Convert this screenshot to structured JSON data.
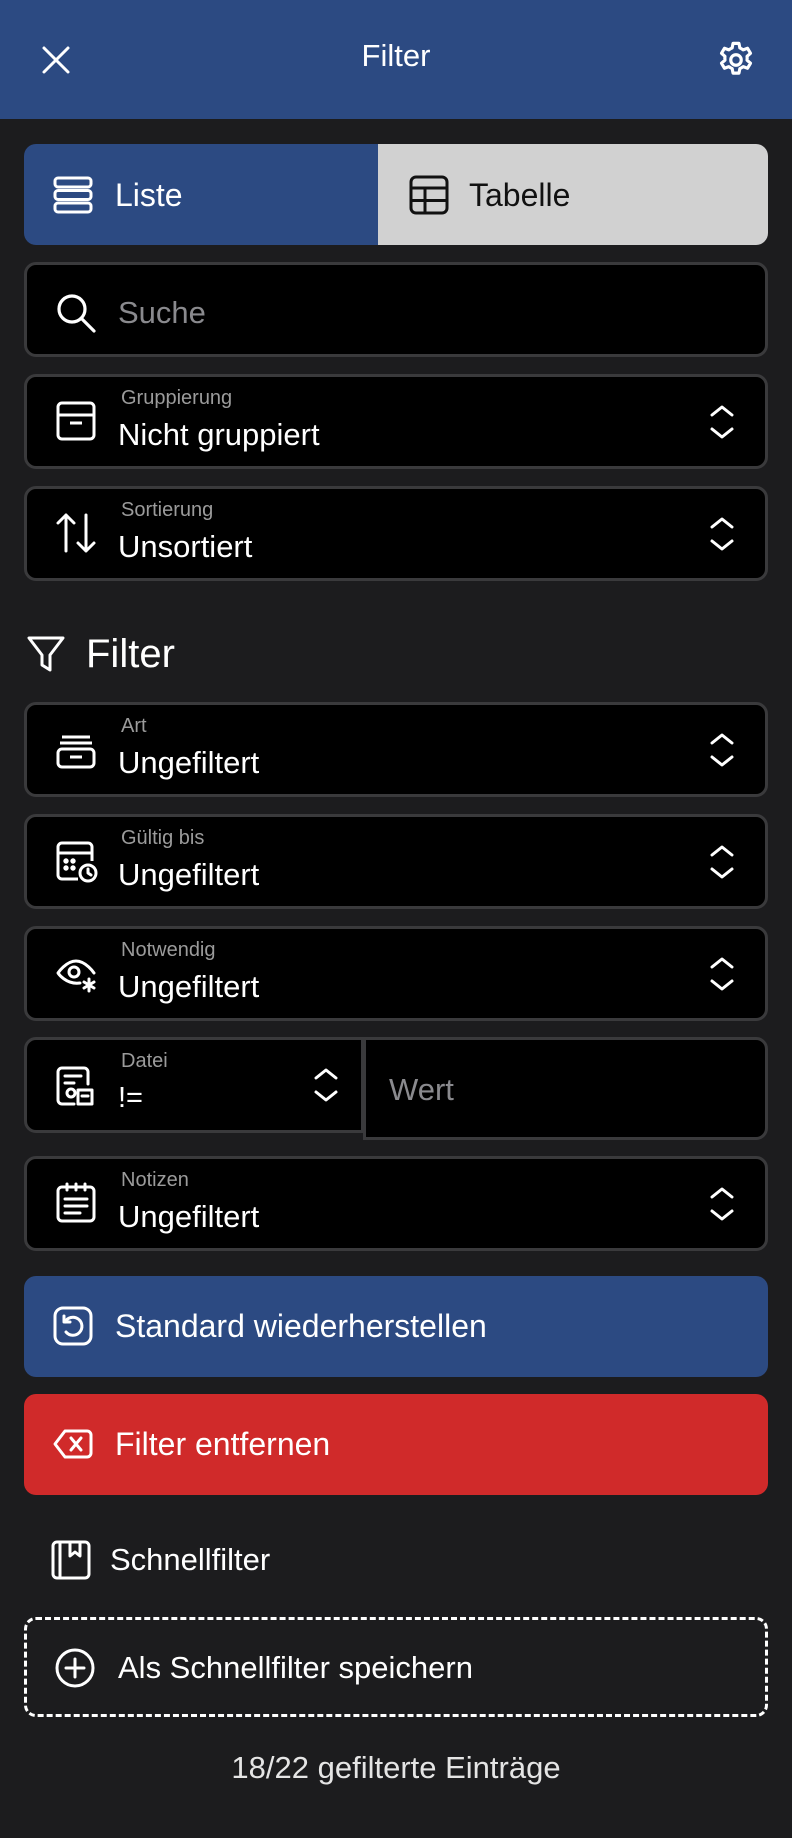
{
  "header": {
    "title": "Filter",
    "close_icon": "close-icon",
    "settings_icon": "gear-icon",
    "background": "#2c4a82"
  },
  "view_toggle": {
    "options": [
      {
        "label": "Liste",
        "icon": "list-icon",
        "selected": true
      },
      {
        "label": "Tabelle",
        "icon": "table-icon",
        "selected": false
      }
    ]
  },
  "search": {
    "placeholder": "Suche",
    "value": ""
  },
  "grouping": {
    "label": "Gruppierung",
    "value": "Nicht gruppiert",
    "icon": "archive-box-icon"
  },
  "sorting": {
    "label": "Sortierung",
    "value": "Unsortiert",
    "icon": "sort-arrows-icon"
  },
  "filter_section": {
    "title": "Filter",
    "icon": "funnel-icon",
    "fields": [
      {
        "label": "Art",
        "value": "Ungefiltert",
        "icon": "inbox-stack-icon"
      },
      {
        "label": "Gültig bis",
        "value": "Ungefiltert",
        "icon": "calendar-clock-icon"
      },
      {
        "label": "Notwendig",
        "value": "Ungefiltert",
        "icon": "eye-asterisk-icon"
      },
      {
        "label": "Datei",
        "value": "!=",
        "icon": "file-attachment-icon",
        "value_placeholder": "Wert"
      },
      {
        "label": "Notizen",
        "value": "Ungefiltert",
        "icon": "notes-icon"
      }
    ]
  },
  "actions": {
    "restore": {
      "label": "Standard wiederherstellen",
      "icon": "restore-icon",
      "color": "#2c4a82"
    },
    "remove": {
      "label": "Filter entfernen",
      "icon": "backspace-x-icon",
      "color": "#d02a2a"
    }
  },
  "quick_filter": {
    "title": "Schnellfilter",
    "icon": "bookmark-book-icon",
    "save_label": "Als Schnellfilter speichern",
    "save_icon": "plus-circle-icon"
  },
  "footer": {
    "count_text": "18/22 gefilterte Einträge"
  }
}
